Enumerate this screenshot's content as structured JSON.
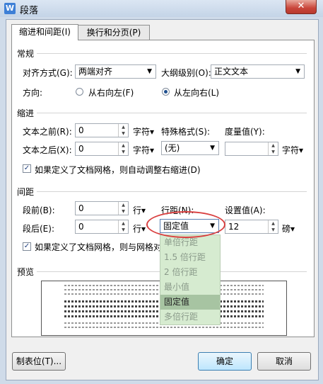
{
  "window": {
    "title": "段落",
    "close_glyph": "✕",
    "app_icon_text": "W"
  },
  "tabs": [
    {
      "label": "缩进和间距(I)"
    },
    {
      "label": "换行和分页(P)"
    }
  ],
  "general": {
    "section_title": "常规",
    "alignment_label": "对齐方式(G):",
    "alignment_value": "两端对齐",
    "outline_label": "大纲级别(O):",
    "outline_value": "正文文本",
    "direction_label": "方向:",
    "rtl_label": "从右向左(F)",
    "ltr_label": "从左向右(L)",
    "direction_selected": "ltr"
  },
  "indent": {
    "section_title": "缩进",
    "before_label": "文本之前(R):",
    "before_value": "0",
    "before_unit": "字符▾",
    "after_label": "文本之后(X):",
    "after_value": "0",
    "after_unit": "字符▾",
    "special_label": "特殊格式(S):",
    "special_value": "(无)",
    "measure_label": "度量值(Y):",
    "measure_value": "",
    "measure_unit": "字符▾",
    "grid_check_label": "如果定义了文档网格，则自动调整右缩进(D)",
    "grid_checked": true
  },
  "spacing": {
    "section_title": "间距",
    "before_label": "段前(B):",
    "before_value": "0",
    "before_unit": "行▾",
    "after_label": "段后(E):",
    "after_value": "0",
    "after_unit": "行▾",
    "line_label": "行距(N):",
    "line_value": "固定值",
    "set_label": "设置值(A):",
    "set_value": "12",
    "set_unit": "磅▾",
    "grid_check_label": "如果定义了文档网格，则与网格对",
    "grid_checked": true,
    "line_options": [
      "单倍行距",
      "1.5 倍行距",
      "2 倍行距",
      "最小值",
      "固定值",
      "多倍行距"
    ],
    "line_selected_index": 4
  },
  "preview": {
    "section_title": "预览"
  },
  "buttons": {
    "tabs_label": "制表位(T)...",
    "ok_label": "确定",
    "cancel_label": "取消"
  },
  "colors": {
    "dropdown_bg": "#d6ebd0",
    "highlight_ring": "#d94040",
    "ok_accent": "#3c7fb1"
  }
}
